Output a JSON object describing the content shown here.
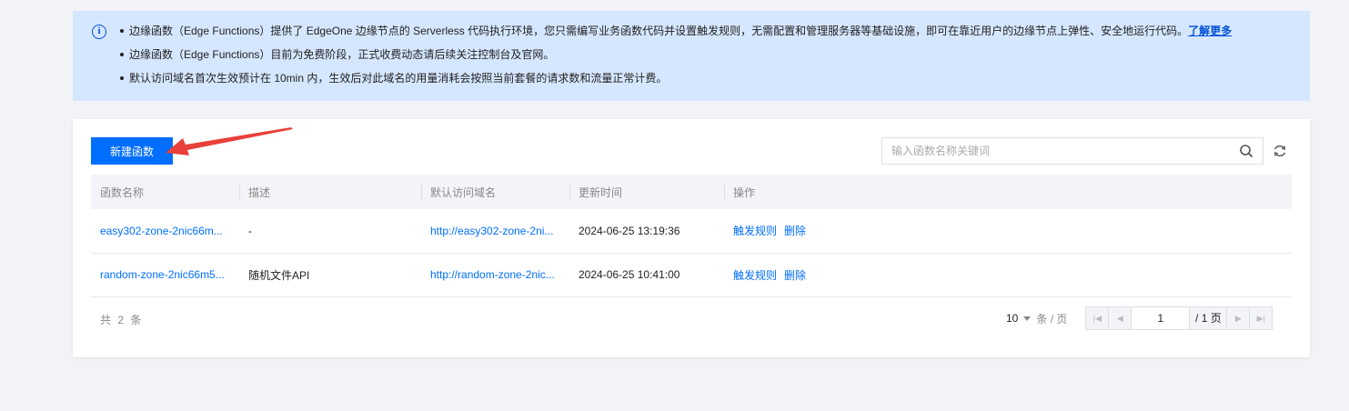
{
  "notice": {
    "items": [
      {
        "text": "边缘函数（Edge Functions）提供了 EdgeOne 边缘节点的 Serverless 代码执行环境，您只需编写业务函数代码并设置触发规则，无需配置和管理服务器等基础设施，即可在靠近用户的边缘节点上弹性、安全地运行代码。",
        "link": "了解更多"
      },
      {
        "text": "边缘函数（Edge Functions）目前为免费阶段，正式收费动态请后续关注控制台及官网。"
      },
      {
        "text": "默认访问域名首次生效预计在 10min 内，生效后对此域名的用量消耗会按照当前套餐的请求数和流量正常计费。"
      }
    ]
  },
  "toolbar": {
    "create_label": "新建函数",
    "search_placeholder": "输入函数名称关键词"
  },
  "table": {
    "headers": [
      "函数名称",
      "描述",
      "默认访问域名",
      "更新时间",
      "操作"
    ],
    "rows": [
      {
        "name": "easy302-zone-2nic66m...",
        "desc": "-",
        "domain": "http://easy302-zone-2ni...",
        "updated": "2024-06-25 13:19:36",
        "op1": "触发规则",
        "op2": "删除"
      },
      {
        "name": "random-zone-2nic66m5...",
        "desc": "随机文件API",
        "domain": "http://random-zone-2nic...",
        "updated": "2024-06-25 10:41:00",
        "op1": "触发规则",
        "op2": "删除"
      }
    ]
  },
  "footer": {
    "total": "共 2 条",
    "page_size": "10",
    "page_size_unit": "条 / 页",
    "current_page": "1",
    "total_pages": "/ 1 页"
  },
  "colors": {
    "primary": "#006eff",
    "notice_bg": "#d5e7ff",
    "annotation_arrow": "#e8403a"
  }
}
